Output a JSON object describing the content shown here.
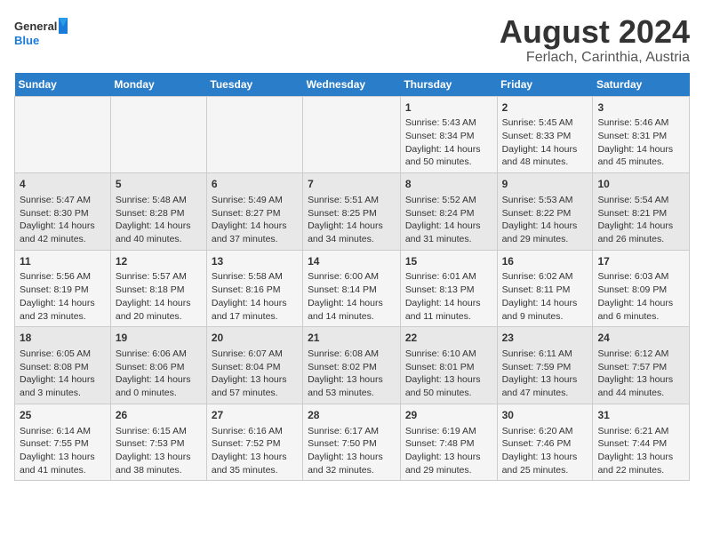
{
  "logo": {
    "line1": "General",
    "line2": "Blue"
  },
  "title": "August 2024",
  "subtitle": "Ferlach, Carinthia, Austria",
  "days_of_week": [
    "Sunday",
    "Monday",
    "Tuesday",
    "Wednesday",
    "Thursday",
    "Friday",
    "Saturday"
  ],
  "weeks": [
    [
      {
        "day": "",
        "sunrise": "",
        "sunset": "",
        "daylight": ""
      },
      {
        "day": "",
        "sunrise": "",
        "sunset": "",
        "daylight": ""
      },
      {
        "day": "",
        "sunrise": "",
        "sunset": "",
        "daylight": ""
      },
      {
        "day": "",
        "sunrise": "",
        "sunset": "",
        "daylight": ""
      },
      {
        "day": "1",
        "sunrise": "5:43 AM",
        "sunset": "8:34 PM",
        "daylight": "14 hours and 50 minutes."
      },
      {
        "day": "2",
        "sunrise": "5:45 AM",
        "sunset": "8:33 PM",
        "daylight": "14 hours and 48 minutes."
      },
      {
        "day": "3",
        "sunrise": "5:46 AM",
        "sunset": "8:31 PM",
        "daylight": "14 hours and 45 minutes."
      }
    ],
    [
      {
        "day": "4",
        "sunrise": "5:47 AM",
        "sunset": "8:30 PM",
        "daylight": "14 hours and 42 minutes."
      },
      {
        "day": "5",
        "sunrise": "5:48 AM",
        "sunset": "8:28 PM",
        "daylight": "14 hours and 40 minutes."
      },
      {
        "day": "6",
        "sunrise": "5:49 AM",
        "sunset": "8:27 PM",
        "daylight": "14 hours and 37 minutes."
      },
      {
        "day": "7",
        "sunrise": "5:51 AM",
        "sunset": "8:25 PM",
        "daylight": "14 hours and 34 minutes."
      },
      {
        "day": "8",
        "sunrise": "5:52 AM",
        "sunset": "8:24 PM",
        "daylight": "14 hours and 31 minutes."
      },
      {
        "day": "9",
        "sunrise": "5:53 AM",
        "sunset": "8:22 PM",
        "daylight": "14 hours and 29 minutes."
      },
      {
        "day": "10",
        "sunrise": "5:54 AM",
        "sunset": "8:21 PM",
        "daylight": "14 hours and 26 minutes."
      }
    ],
    [
      {
        "day": "11",
        "sunrise": "5:56 AM",
        "sunset": "8:19 PM",
        "daylight": "14 hours and 23 minutes."
      },
      {
        "day": "12",
        "sunrise": "5:57 AM",
        "sunset": "8:18 PM",
        "daylight": "14 hours and 20 minutes."
      },
      {
        "day": "13",
        "sunrise": "5:58 AM",
        "sunset": "8:16 PM",
        "daylight": "14 hours and 17 minutes."
      },
      {
        "day": "14",
        "sunrise": "6:00 AM",
        "sunset": "8:14 PM",
        "daylight": "14 hours and 14 minutes."
      },
      {
        "day": "15",
        "sunrise": "6:01 AM",
        "sunset": "8:13 PM",
        "daylight": "14 hours and 11 minutes."
      },
      {
        "day": "16",
        "sunrise": "6:02 AM",
        "sunset": "8:11 PM",
        "daylight": "14 hours and 9 minutes."
      },
      {
        "day": "17",
        "sunrise": "6:03 AM",
        "sunset": "8:09 PM",
        "daylight": "14 hours and 6 minutes."
      }
    ],
    [
      {
        "day": "18",
        "sunrise": "6:05 AM",
        "sunset": "8:08 PM",
        "daylight": "14 hours and 3 minutes."
      },
      {
        "day": "19",
        "sunrise": "6:06 AM",
        "sunset": "8:06 PM",
        "daylight": "14 hours and 0 minutes."
      },
      {
        "day": "20",
        "sunrise": "6:07 AM",
        "sunset": "8:04 PM",
        "daylight": "13 hours and 57 minutes."
      },
      {
        "day": "21",
        "sunrise": "6:08 AM",
        "sunset": "8:02 PM",
        "daylight": "13 hours and 53 minutes."
      },
      {
        "day": "22",
        "sunrise": "6:10 AM",
        "sunset": "8:01 PM",
        "daylight": "13 hours and 50 minutes."
      },
      {
        "day": "23",
        "sunrise": "6:11 AM",
        "sunset": "7:59 PM",
        "daylight": "13 hours and 47 minutes."
      },
      {
        "day": "24",
        "sunrise": "6:12 AM",
        "sunset": "7:57 PM",
        "daylight": "13 hours and 44 minutes."
      }
    ],
    [
      {
        "day": "25",
        "sunrise": "6:14 AM",
        "sunset": "7:55 PM",
        "daylight": "13 hours and 41 minutes."
      },
      {
        "day": "26",
        "sunrise": "6:15 AM",
        "sunset": "7:53 PM",
        "daylight": "13 hours and 38 minutes."
      },
      {
        "day": "27",
        "sunrise": "6:16 AM",
        "sunset": "7:52 PM",
        "daylight": "13 hours and 35 minutes."
      },
      {
        "day": "28",
        "sunrise": "6:17 AM",
        "sunset": "7:50 PM",
        "daylight": "13 hours and 32 minutes."
      },
      {
        "day": "29",
        "sunrise": "6:19 AM",
        "sunset": "7:48 PM",
        "daylight": "13 hours and 29 minutes."
      },
      {
        "day": "30",
        "sunrise": "6:20 AM",
        "sunset": "7:46 PM",
        "daylight": "13 hours and 25 minutes."
      },
      {
        "day": "31",
        "sunrise": "6:21 AM",
        "sunset": "7:44 PM",
        "daylight": "13 hours and 22 minutes."
      }
    ]
  ],
  "labels": {
    "sunrise": "Sunrise:",
    "sunset": "Sunset:",
    "daylight": "Daylight:"
  }
}
